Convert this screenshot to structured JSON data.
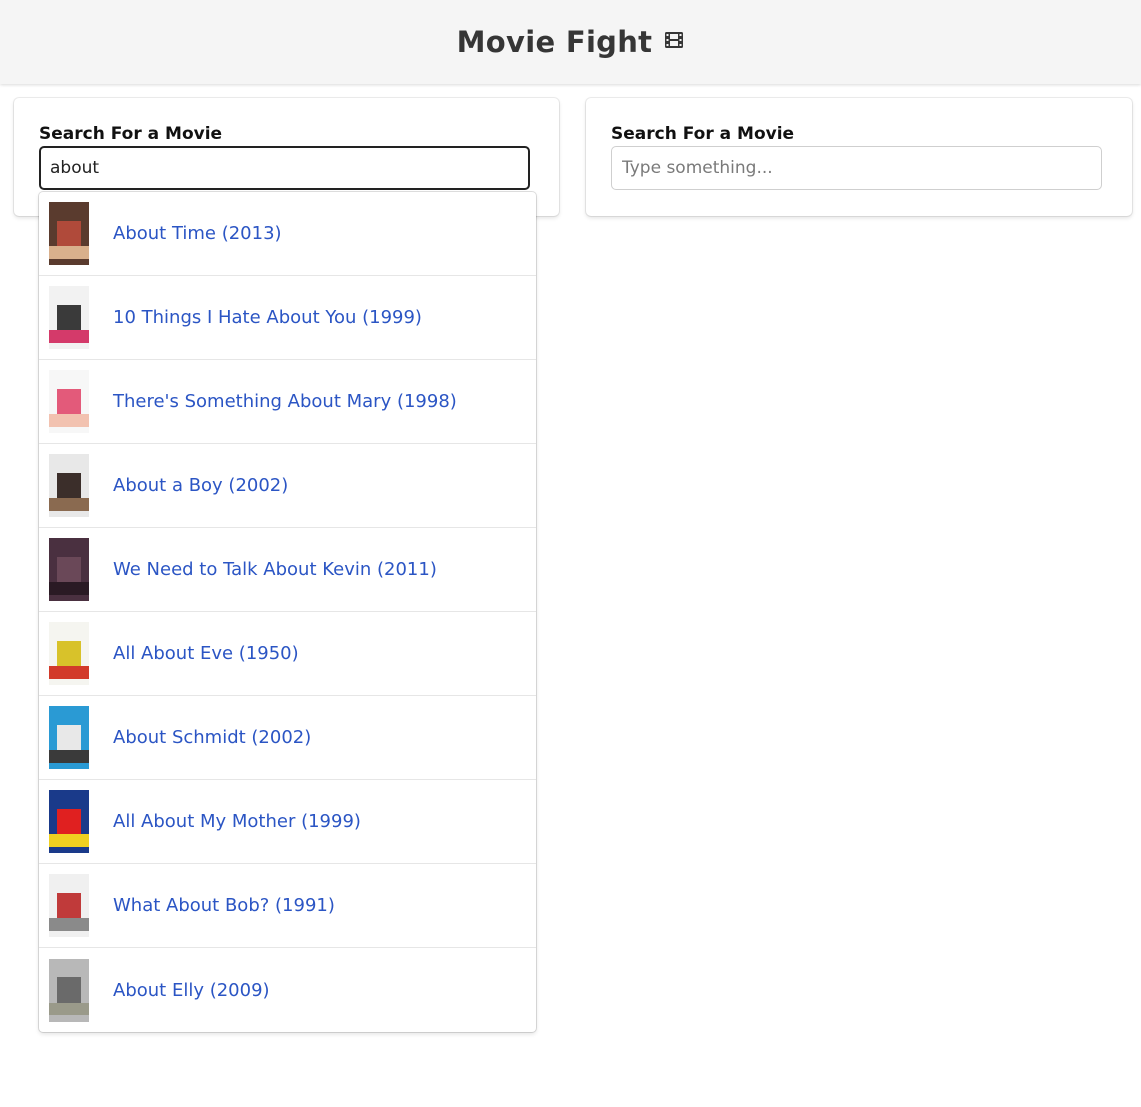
{
  "header": {
    "title": "Movie Fight",
    "icon": "film-icon"
  },
  "left_panel": {
    "label": "Search For a Movie",
    "input_value": "about"
  },
  "right_panel": {
    "label": "Search For a Movie",
    "placeholder": "Type something..."
  },
  "results": [
    {
      "title": "About Time (2013)",
      "colors": [
        "#5a3b2e",
        "#b04a3a",
        "#d9b08c"
      ]
    },
    {
      "title": "10 Things I Hate About You (1999)",
      "colors": [
        "#f2f2f2",
        "#3a3a3a",
        "#d43a6a"
      ]
    },
    {
      "title": "There's Something About Mary (1998)",
      "colors": [
        "#f7f7f7",
        "#e35a7a",
        "#f2c2b0"
      ]
    },
    {
      "title": "About a Boy (2002)",
      "colors": [
        "#e8e8e8",
        "#3b2e2a",
        "#8a6a50"
      ]
    },
    {
      "title": "We Need to Talk About Kevin (2011)",
      "colors": [
        "#4a3040",
        "#6a4858",
        "#2a1a24"
      ]
    },
    {
      "title": "All About Eve (1950)",
      "colors": [
        "#f5f5f0",
        "#d8c22a",
        "#d23a2a"
      ]
    },
    {
      "title": "About Schmidt (2002)",
      "colors": [
        "#2a9ad4",
        "#e8e8e8",
        "#3a3a3a"
      ]
    },
    {
      "title": "All About My Mother (1999)",
      "colors": [
        "#1a3a8a",
        "#e02020",
        "#f0d020"
      ]
    },
    {
      "title": "What About Bob? (1991)",
      "colors": [
        "#f0f0f0",
        "#c03a3a",
        "#8a8a8a"
      ]
    },
    {
      "title": "About Elly (2009)",
      "colors": [
        "#b8b8b8",
        "#6a6a6a",
        "#9a9a8a"
      ]
    }
  ],
  "colors": {
    "link": "#2b55c4",
    "header_bg": "#f5f5f5"
  }
}
